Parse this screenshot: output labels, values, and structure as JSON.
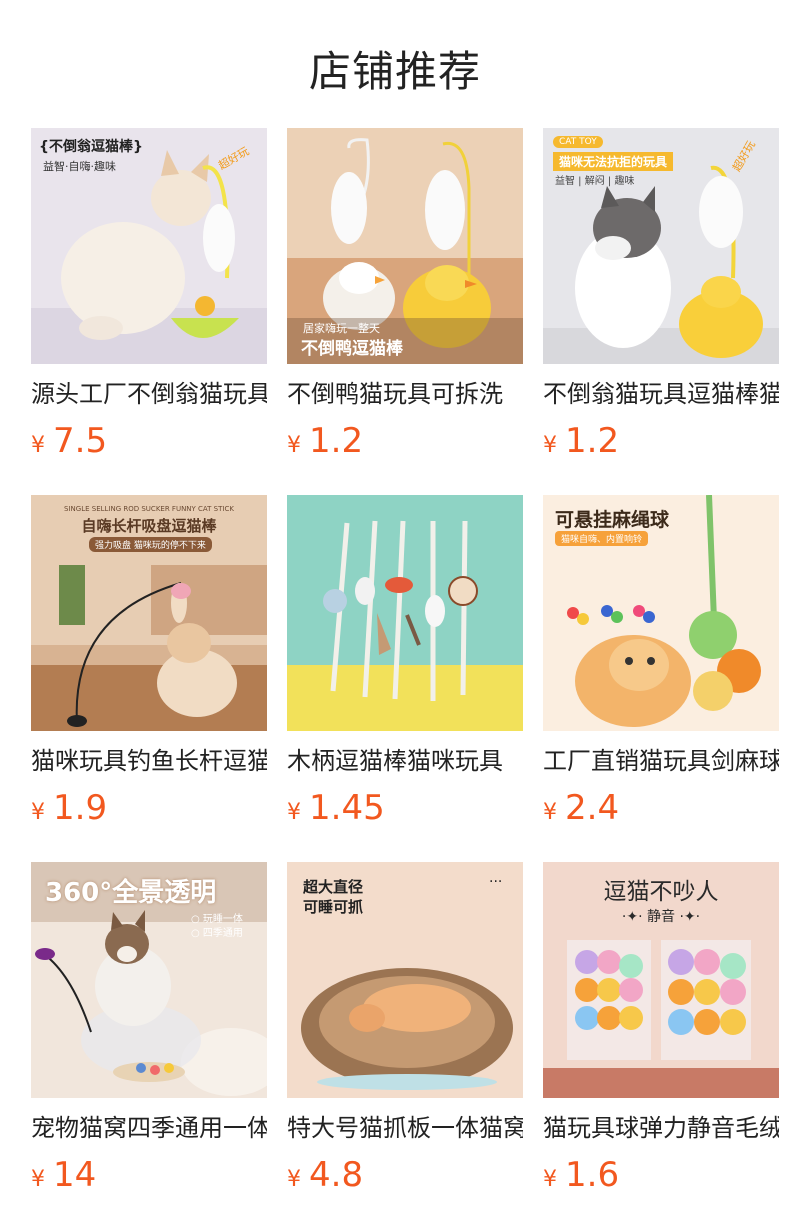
{
  "page": {
    "title": "店铺推荐"
  },
  "currency": "¥",
  "products": [
    {
      "name": "源头工厂不倒翁猫玩具",
      "price": "7.5",
      "overlay": {
        "title": "{不倒翁逗猫棒}",
        "sub": "益智·自嗨·趣味",
        "tag": "超好玩"
      }
    },
    {
      "name": "不倒鸭猫玩具可拆洗",
      "price": "1.2",
      "overlay": {
        "small": "居家嗨玩一整天",
        "title": "不倒鸭逗猫棒"
      }
    },
    {
      "name": "不倒翁猫玩具逗猫棒猫",
      "price": "1.2",
      "overlay": {
        "badge": "CAT TOY",
        "title": "猫咪无法抗拒的玩具",
        "sub": "益智 | 解闷 | 趣味",
        "tag": "超好玩"
      }
    },
    {
      "name": "猫咪玩具钓鱼长杆逗猫",
      "price": "1.9",
      "overlay": {
        "small": "SINGLE SELLING ROD SUCKER FUNNY CAT STICK",
        "title": "自嗨长杆吸盘逗猫棒",
        "sub": "强力吸盘 猫咪玩的停不下来"
      }
    },
    {
      "name": "木柄逗猫棒猫咪玩具",
      "price": "1.45",
      "overlay": {}
    },
    {
      "name": "工厂直销猫玩具剑麻球",
      "price": "2.4",
      "overlay": {
        "title": "可悬挂麻绳球",
        "sub": "猫咪自嗨、内置响铃"
      }
    },
    {
      "name": "宠物猫窝四季通用一体",
      "price": "14",
      "overlay": {
        "title": "360°全景透明",
        "line1": "玩睡一体",
        "line2": "四季通用"
      }
    },
    {
      "name": "特大号猫抓板一体猫窝",
      "price": "4.8",
      "overlay": {
        "title": "超大直径",
        "sub": "可睡可抓",
        "more": "···"
      }
    },
    {
      "name": "猫玩具球弹力静音毛绒",
      "price": "1.6",
      "overlay": {
        "title": "逗猫不吵人",
        "sub": "静音"
      }
    }
  ],
  "colors": {
    "price": "#f2581f",
    "title": "#222222"
  }
}
